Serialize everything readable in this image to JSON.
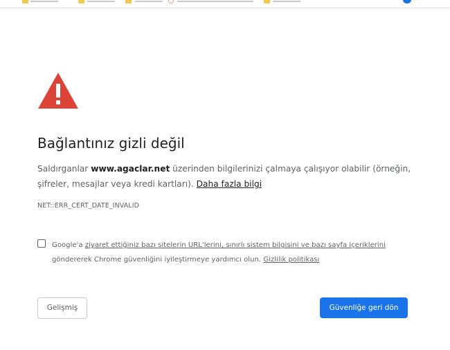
{
  "page": {
    "heading": "Bağlantınız gizli değil",
    "description": {
      "before": "Saldırganlar ",
      "site": "www.agaclar.net",
      "after": " üzerinden bilgilerinizi çalmaya çalışıyor olabilir (örneğin, şifreler, mesajlar veya kredi kartları). ",
      "learn_more_link": "Daha fazla bilgi"
    },
    "error_code": "NET::ERR_CERT_DATE_INVALID",
    "optin": {
      "prefix": "Google'a ",
      "link": "ziyaret ettiğiniz bazı sitelerin URL'lerini, sınırlı sistem bilgisini ve bazı sayfa içeriklerini",
      "middle": " göndererek Chrome güvenliğini iyileştirmeye yardımcı olun. ",
      "privacy_link": "Gizlilik politikası",
      "checked": false
    },
    "buttons": {
      "advanced": "Gelişmiş",
      "back_to_safety": "Güvenliğe geri dön"
    }
  },
  "colors": {
    "warning_red": "#db4437",
    "primary_blue": "#1a73e8",
    "heading_text": "#202124",
    "body_text": "#5f6368"
  },
  "icons": {
    "warning": "warning-triangle-icon"
  }
}
